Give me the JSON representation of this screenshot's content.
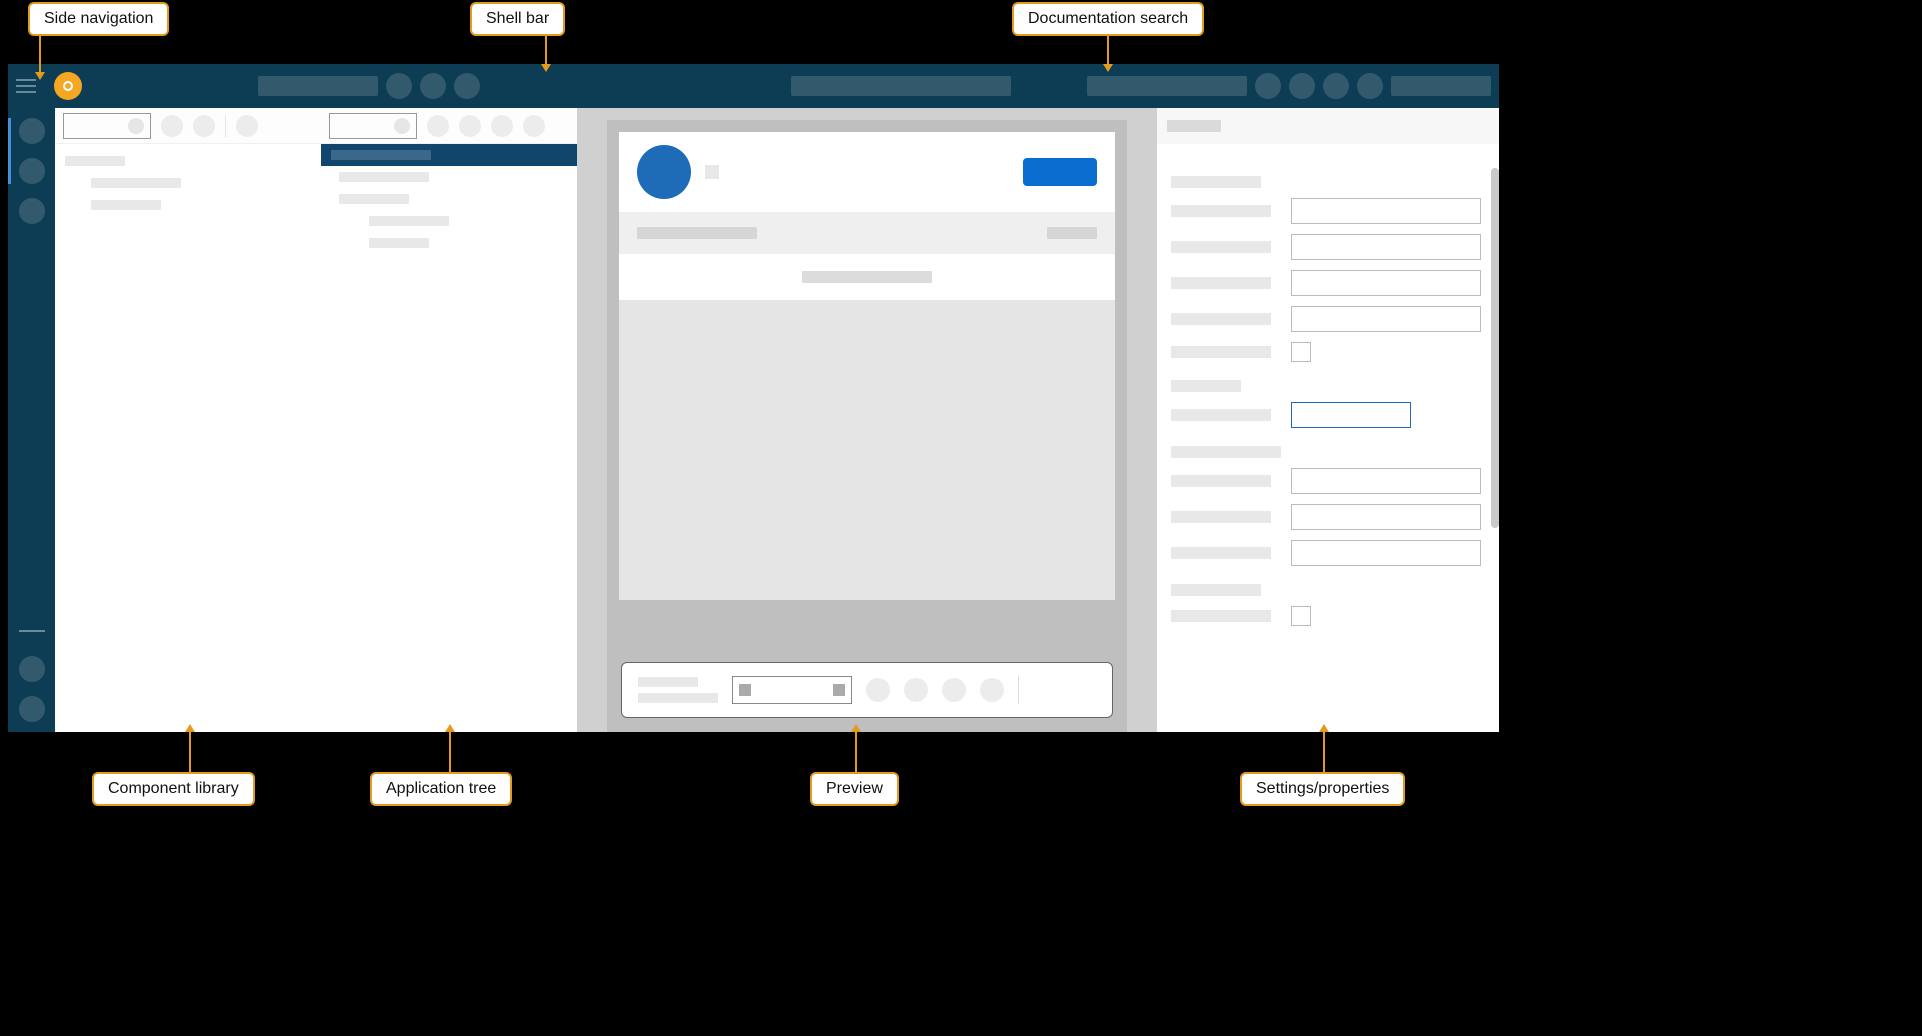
{
  "annotations": {
    "side_nav": "Side navigation",
    "shell_bar": "Shell bar",
    "doc_search": "Documentation search",
    "component_library": "Component library",
    "application_tree": "Application tree",
    "preview": "Preview",
    "settings": "Settings/properties"
  }
}
